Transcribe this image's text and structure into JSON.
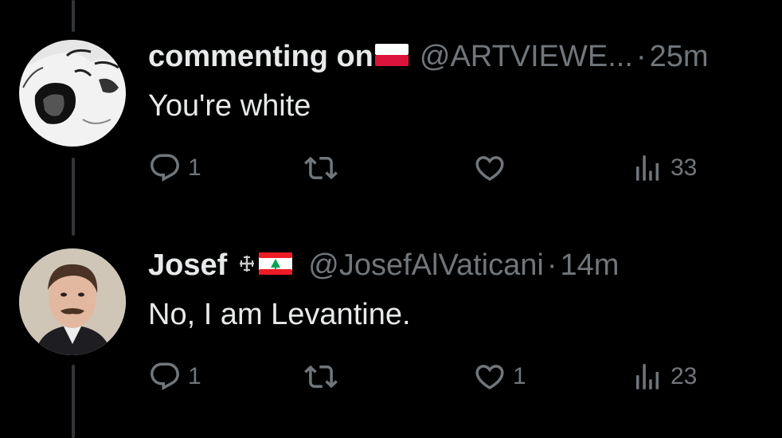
{
  "tweets": [
    {
      "name": "commenting on",
      "handle": "@ARTVIEWE...",
      "separator": "·",
      "time": "25m",
      "text": "You're white",
      "flag_icon": "poland-flag-icon",
      "reply_count": "1",
      "retweet_count": "",
      "like_count": "",
      "view_count": "33"
    },
    {
      "name": "Josef",
      "handle": "@JosefAlVaticani",
      "separator": "·",
      "time": "14m",
      "text": "No, I am Levantine.",
      "flag_icon": "lebanon-flag-icon",
      "cross_icon": "cross-icon",
      "reply_count": "1",
      "retweet_count": "",
      "like_count": "1",
      "view_count": "23"
    }
  ],
  "colors": {
    "background": "#000000",
    "primary_text": "#e7e9ea",
    "secondary_text": "#71767b",
    "thread_line": "#333639"
  }
}
